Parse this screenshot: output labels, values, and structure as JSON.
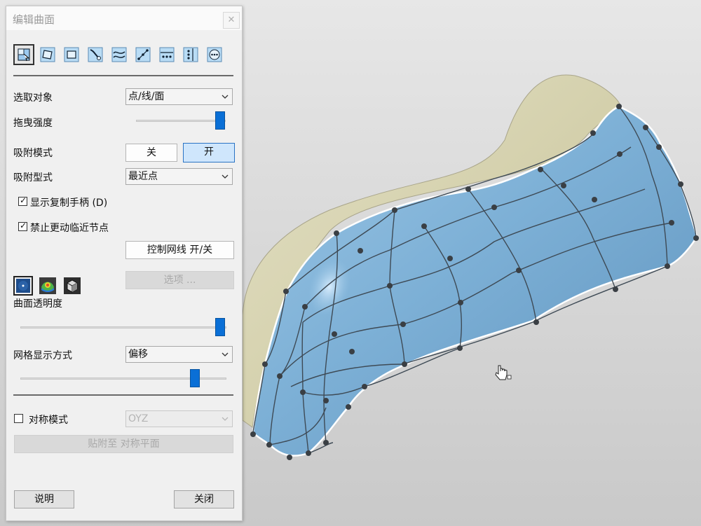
{
  "dialog": {
    "title": "编辑曲面",
    "close_icon": "close-icon",
    "tools": [
      {
        "name": "select-region-tool-icon",
        "active": true
      },
      {
        "name": "quad-tool-icon",
        "active": false
      },
      {
        "name": "rectangle-tool-icon",
        "active": false
      },
      {
        "name": "brush-tool-icon",
        "active": false
      },
      {
        "name": "wave-tool-icon",
        "active": false
      },
      {
        "name": "line-points-tool-icon",
        "active": false
      },
      {
        "name": "horizontal-points-tool-icon",
        "active": false
      },
      {
        "name": "vertical-points-tool-icon",
        "active": false
      },
      {
        "name": "circle-points-tool-icon",
        "active": false
      }
    ],
    "select_object": {
      "label": "选取对象",
      "value": "点/线/面"
    },
    "drag_strength": {
      "label": "拖曳强度",
      "value": 0.97
    },
    "snap_mode": {
      "label": "吸附模式",
      "off_label": "关",
      "on_label": "开",
      "selected": "on"
    },
    "snap_type": {
      "label": "吸附型式",
      "value": "最近点"
    },
    "show_copy_handle": {
      "label": "显示复制手柄 (D)",
      "checked": true
    },
    "no_move_neighbors": {
      "label": "禁止更动临近节点",
      "checked": true
    },
    "control_mesh_button": "控制网线 开/关",
    "render_modes": [
      "sphere-shading-icon",
      "color-map-icon",
      "cube-shading-icon"
    ],
    "options_button": "选项 ...",
    "transparency": {
      "label": "曲面透明度",
      "value": 0.99
    },
    "mesh_display": {
      "label": "网格显示方式",
      "value": "偏移",
      "slider": 0.85
    },
    "symmetry": {
      "label": "对称模式",
      "checked": false,
      "plane": "OYZ"
    },
    "snap_to_plane_button": "贴附至 对称平面",
    "help_button": "说明",
    "close_button": "关闭"
  },
  "viewport": {
    "surface_color": "#7db0d6",
    "backing_color": "#d9d5b4",
    "background_color": "#d6d6d6",
    "cursor_icon": "hand-cursor-icon"
  }
}
